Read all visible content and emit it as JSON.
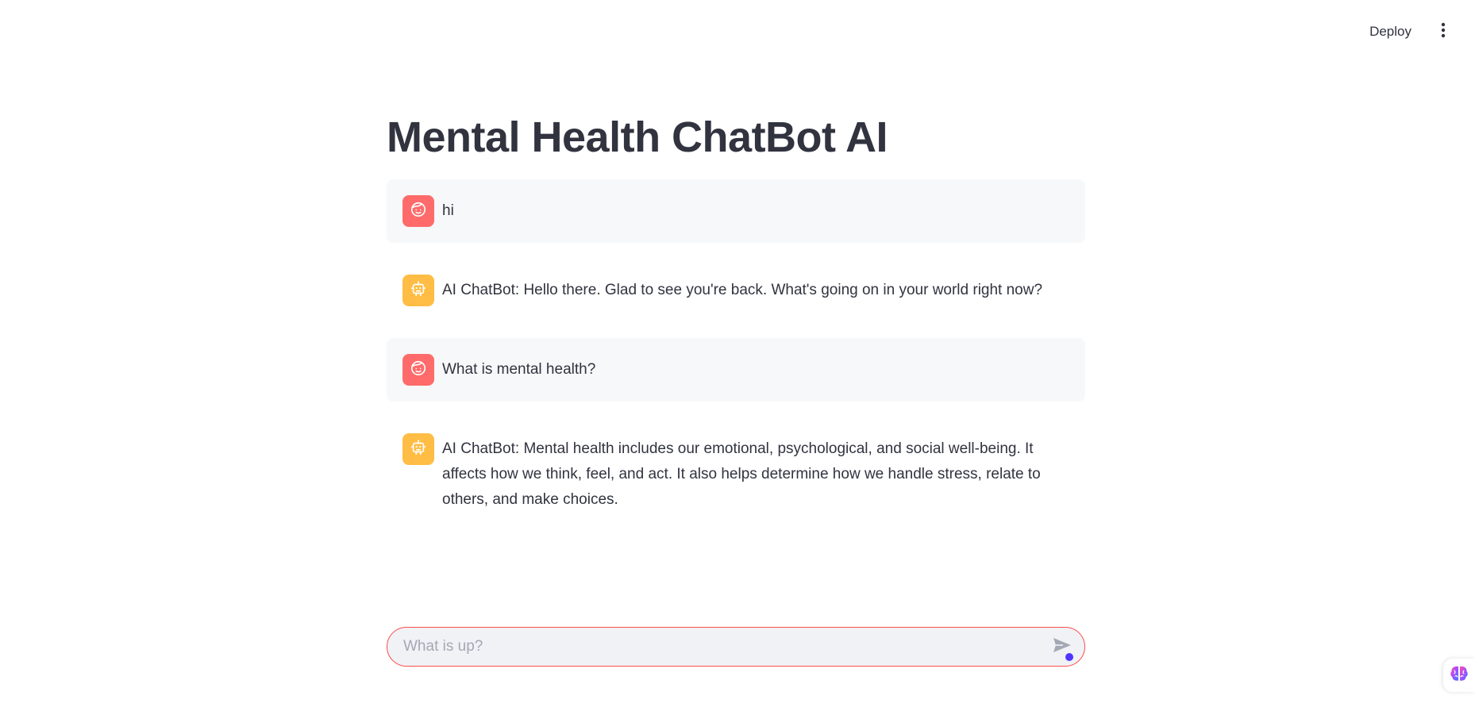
{
  "header": {
    "deploy_label": "Deploy",
    "menu_icon": "vertical-dots-icon"
  },
  "page": {
    "title": "Mental Health ChatBot AI"
  },
  "messages": [
    {
      "role": "user",
      "avatar_icon": "user-face-icon",
      "text": "hi"
    },
    {
      "role": "assistant",
      "avatar_icon": "robot-icon",
      "text": "AI ChatBot: Hello there. Glad to see you're back. What's going on in your world right now?"
    },
    {
      "role": "user",
      "avatar_icon": "user-face-icon",
      "text": "What is mental health?"
    },
    {
      "role": "assistant",
      "avatar_icon": "robot-icon",
      "text": "AI ChatBot: Mental health includes our emotional, psychological, and social well-being. It affects how we think, feel, and act. It also helps determine how we handle stress, relate to others, and make choices."
    }
  ],
  "chat_input": {
    "placeholder": "What is up?",
    "value": ""
  },
  "colors": {
    "user_avatar": "#ff6b6b",
    "assistant_avatar": "#ffbd45",
    "input_border": "#ff4b4b",
    "user_bubble": "#f7f8fa"
  }
}
